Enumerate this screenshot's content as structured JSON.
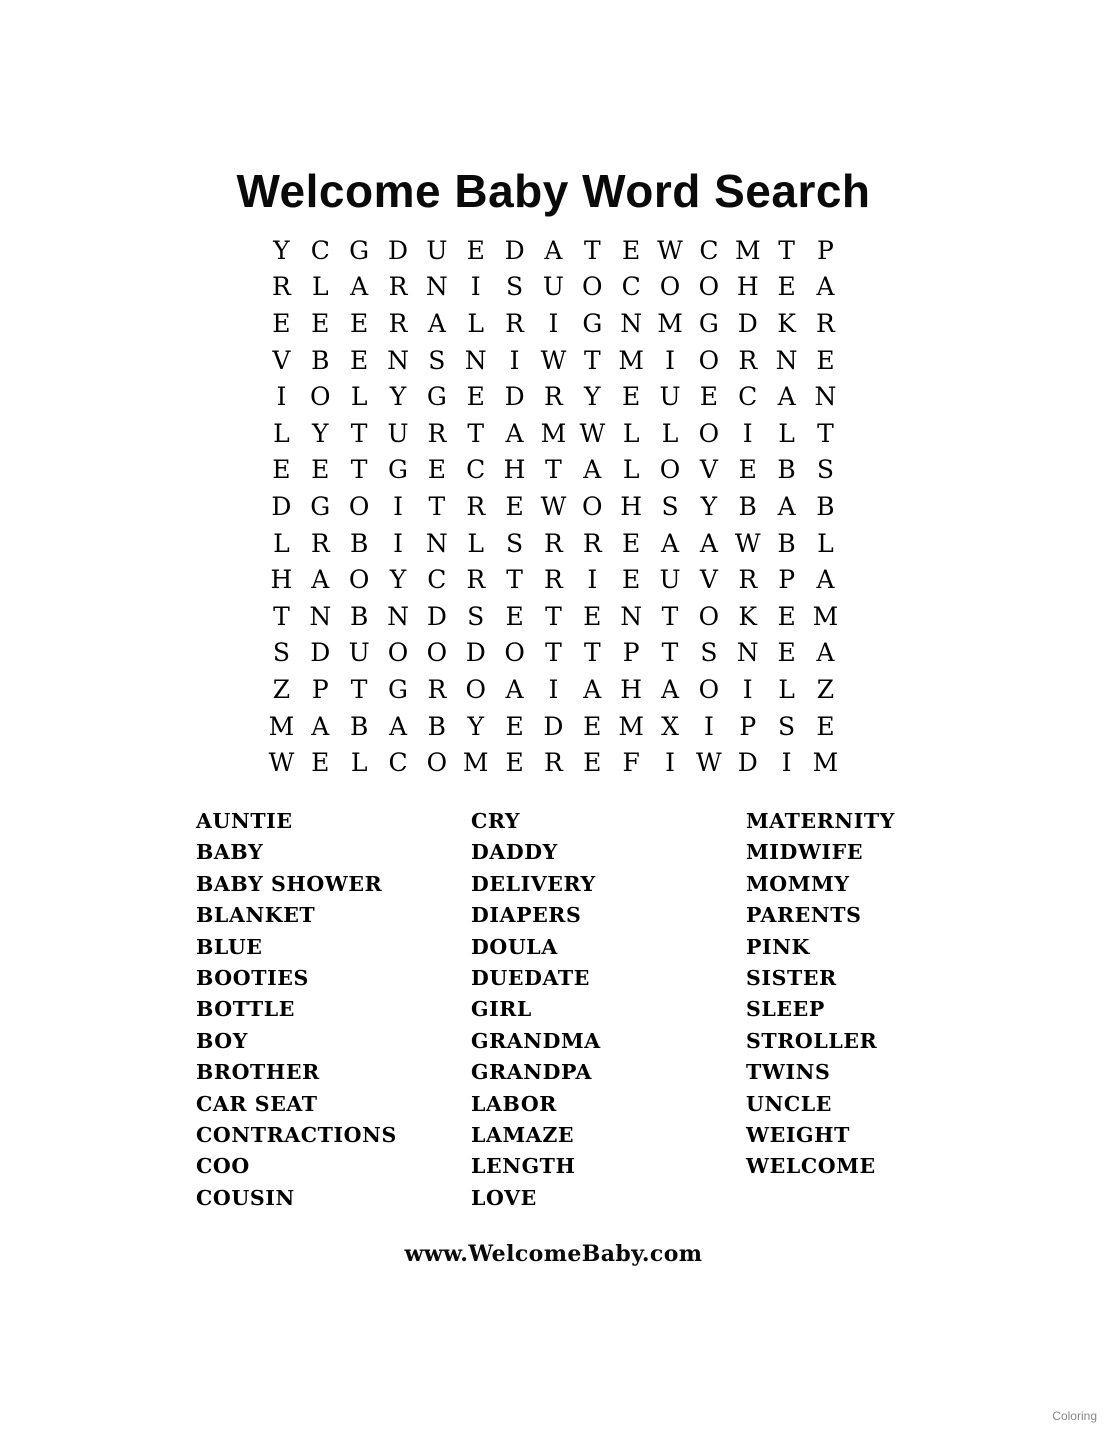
{
  "page": {
    "title": "Welcome Baby Word Search",
    "background_color": "#ffffff",
    "text_color": "#000000"
  },
  "footer": {
    "url": "www.WelcomeBaby.com",
    "watermark": "Coloring",
    "watermark_color": "#878787"
  },
  "puzzle": {
    "rows": 15,
    "cols": 15,
    "grid": [
      [
        "Y",
        "C",
        "G",
        "D",
        "U",
        "E",
        "D",
        "A",
        "T",
        "E",
        "W",
        "C",
        "M",
        "T",
        "P"
      ],
      [
        "R",
        "L",
        "A",
        "R",
        "N",
        "I",
        "S",
        "U",
        "O",
        "C",
        "O",
        "O",
        "H",
        "E",
        "A"
      ],
      [
        "E",
        "E",
        "E",
        "R",
        "A",
        "L",
        "R",
        "I",
        "G",
        "N",
        "M",
        "G",
        "D",
        "K",
        "R"
      ],
      [
        "V",
        "B",
        "E",
        "N",
        "S",
        "N",
        "I",
        "W",
        "T",
        "M",
        "I",
        "O",
        "R",
        "N",
        "E"
      ],
      [
        "I",
        "O",
        "L",
        "Y",
        "G",
        "E",
        "D",
        "R",
        "Y",
        "E",
        "U",
        "E",
        "C",
        "A",
        "N"
      ],
      [
        "L",
        "Y",
        "T",
        "U",
        "R",
        "T",
        "A",
        "M",
        "W",
        "L",
        "L",
        "O",
        "I",
        "L",
        "T"
      ],
      [
        "E",
        "E",
        "T",
        "G",
        "E",
        "C",
        "H",
        "T",
        "A",
        "L",
        "O",
        "V",
        "E",
        "B",
        "S"
      ],
      [
        "D",
        "G",
        "O",
        "I",
        "T",
        "R",
        "E",
        "W",
        "O",
        "H",
        "S",
        "Y",
        "B",
        "A",
        "B"
      ],
      [
        "L",
        "R",
        "B",
        "I",
        "N",
        "L",
        "S",
        "R",
        "R",
        "E",
        "A",
        "A",
        "W",
        "B",
        "L"
      ],
      [
        "H",
        "A",
        "O",
        "Y",
        "C",
        "R",
        "T",
        "R",
        "I",
        "E",
        "U",
        "V",
        "R",
        "P",
        "A"
      ],
      [
        "T",
        "N",
        "B",
        "N",
        "D",
        "S",
        "E",
        "T",
        "E",
        "N",
        "T",
        "O",
        "K",
        "E",
        "M"
      ],
      [
        "S",
        "D",
        "U",
        "O",
        "O",
        "D",
        "O",
        "T",
        "T",
        "P",
        "T",
        "S",
        "N",
        "E",
        "A"
      ],
      [
        "Z",
        "P",
        "T",
        "G",
        "R",
        "O",
        "A",
        "I",
        "A",
        "H",
        "A",
        "O",
        "I",
        "L",
        "Z"
      ],
      [
        "M",
        "A",
        "B",
        "A",
        "B",
        "Y",
        "E",
        "D",
        "E",
        "M",
        "X",
        "I",
        "P",
        "S",
        "E"
      ],
      [
        "W",
        "E",
        "L",
        "C",
        "O",
        "M",
        "E",
        "R",
        "E",
        "F",
        "I",
        "W",
        "D",
        "I",
        "M"
      ]
    ]
  },
  "word_list": {
    "columns": [
      {
        "words": [
          "AUNTIE",
          "BABY",
          "BABY SHOWER",
          "BLANKET",
          "BLUE",
          "BOOTIES",
          "BOTTLE",
          "BOY",
          "BROTHER",
          "CAR SEAT",
          "CONTRACTIONS",
          "COO",
          "COUSIN"
        ]
      },
      {
        "words": [
          "CRY",
          "DADDY",
          "DELIVERY",
          "DIAPERS",
          "DOULA",
          "DUEDATE",
          "GIRL",
          "GRANDMA",
          "GRANDPA",
          "LABOR",
          "LAMAZE",
          "LENGTH",
          "LOVE"
        ]
      },
      {
        "words": [
          "MATERNITY",
          "MIDWIFE",
          "MOMMY",
          "PARENTS",
          "PINK",
          "SISTER",
          "SLEEP",
          "STROLLER",
          "TWINS",
          "UNCLE",
          "WEIGHT",
          "WELCOME"
        ]
      }
    ]
  }
}
